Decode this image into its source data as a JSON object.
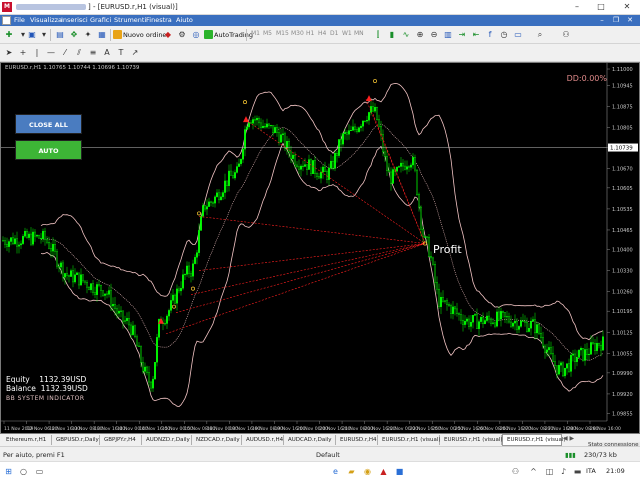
{
  "window": {
    "title": "] - [EURUSD.r,H1 (visual)]",
    "minimize": "–",
    "maximize": "□",
    "close": "✕"
  },
  "menu": {
    "items": [
      "File",
      "Visualizza",
      "Inserisci",
      "Grafici",
      "Strumenti",
      "Finestra",
      "Aiuto"
    ],
    "mdi_minimize": "–",
    "mdi_restore": "❐",
    "mdi_close": "✕"
  },
  "toolbar": {
    "new_order_label": "Nuovo ordine",
    "autotrading_label": "AutoTrading",
    "timeframes": [
      "M1",
      "M5",
      "M15",
      "M30",
      "H1",
      "H4",
      "D1",
      "W1",
      "MN"
    ]
  },
  "chart": {
    "info": "EURUSD.r,H1  1.10765  1.10744  1.10696  1.10739",
    "dd_label": "DD:0.00%",
    "close_all_label": "CLOSE ALL",
    "auto_label": "AUTO",
    "profit_label": "Profit",
    "equity_label": "Equity",
    "equity_value": "1132.39USD",
    "balance_label": "Balance",
    "balance_value": "1132.39USD",
    "indicator_label": "BB SYSTEM INDICATOR",
    "current_price": "1.10739",
    "price_labels": [
      "1.11000",
      "1.10945",
      "1.10875",
      "1.10805",
      "1.10740",
      "1.10670",
      "1.10605",
      "1.10535",
      "1.10465",
      "1.10400",
      "1.10330",
      "1.10260",
      "1.10195",
      "1.10125",
      "1.10055",
      "1.09990",
      "1.09920",
      "1.09855"
    ],
    "date_labels": [
      "11 Nov 2019",
      "12 Nov 06:00",
      "12 Nov 16:00",
      "13 Nov 08:00",
      "13 Nov 16:00",
      "14 Nov 00:00",
      "14 Nov 16:00",
      "15 Nov 00:00",
      "15 Nov 08:00",
      "18 Nov 00:00",
      "18 Nov 16:00",
      "19 Nov 08:00",
      "19 Nov 16:00",
      "20 Nov 00:00",
      "20 Nov 16:00",
      "21 Nov 08:00",
      "21 Nov 16:00",
      "22 Nov 00:00",
      "22 Nov 16:00",
      "25 Nov 00:00",
      "25 Nov 16:00",
      "26 Nov 08:00",
      "26 Nov 16:00",
      "27 Nov 08:00",
      "27 Nov 16:00",
      "28 Nov 08:00",
      "28 Nov 16:00"
    ]
  },
  "tabs": [
    {
      "label": "Ethereum.r,H1"
    },
    {
      "label": "GBPUSD.r,Daily"
    },
    {
      "label": "GBPJPY.r,H4"
    },
    {
      "label": "AUDNZD.r,Daily"
    },
    {
      "label": "NZDCAD.r,Daily"
    },
    {
      "label": "AUDUSD.r,H4"
    },
    {
      "label": "AUDCAD.r,Daily"
    },
    {
      "label": "EURUSD.r,H4"
    },
    {
      "label": "EURUSD.r,H1 (visual)"
    },
    {
      "label": "EURUSD.r,H1 (visual)"
    },
    {
      "label": "EURUSD.r,H1 (visual)"
    }
  ],
  "tab_nav": "◀ ▶",
  "status": {
    "help": "Per aiuto, premi F1",
    "profile": "Default",
    "connection": "Stato connessione",
    "traffic": "230/73 kb"
  },
  "taskbar": {
    "lang": "ITA",
    "time": "21:09"
  },
  "colors": {
    "candles": "#00ff00",
    "bands": "#f2c4c4",
    "signal_lines": "#ff2020",
    "chart_bg": "#000000",
    "close_all_btn": "#4a7cc0",
    "auto_btn": "#3db536"
  }
}
